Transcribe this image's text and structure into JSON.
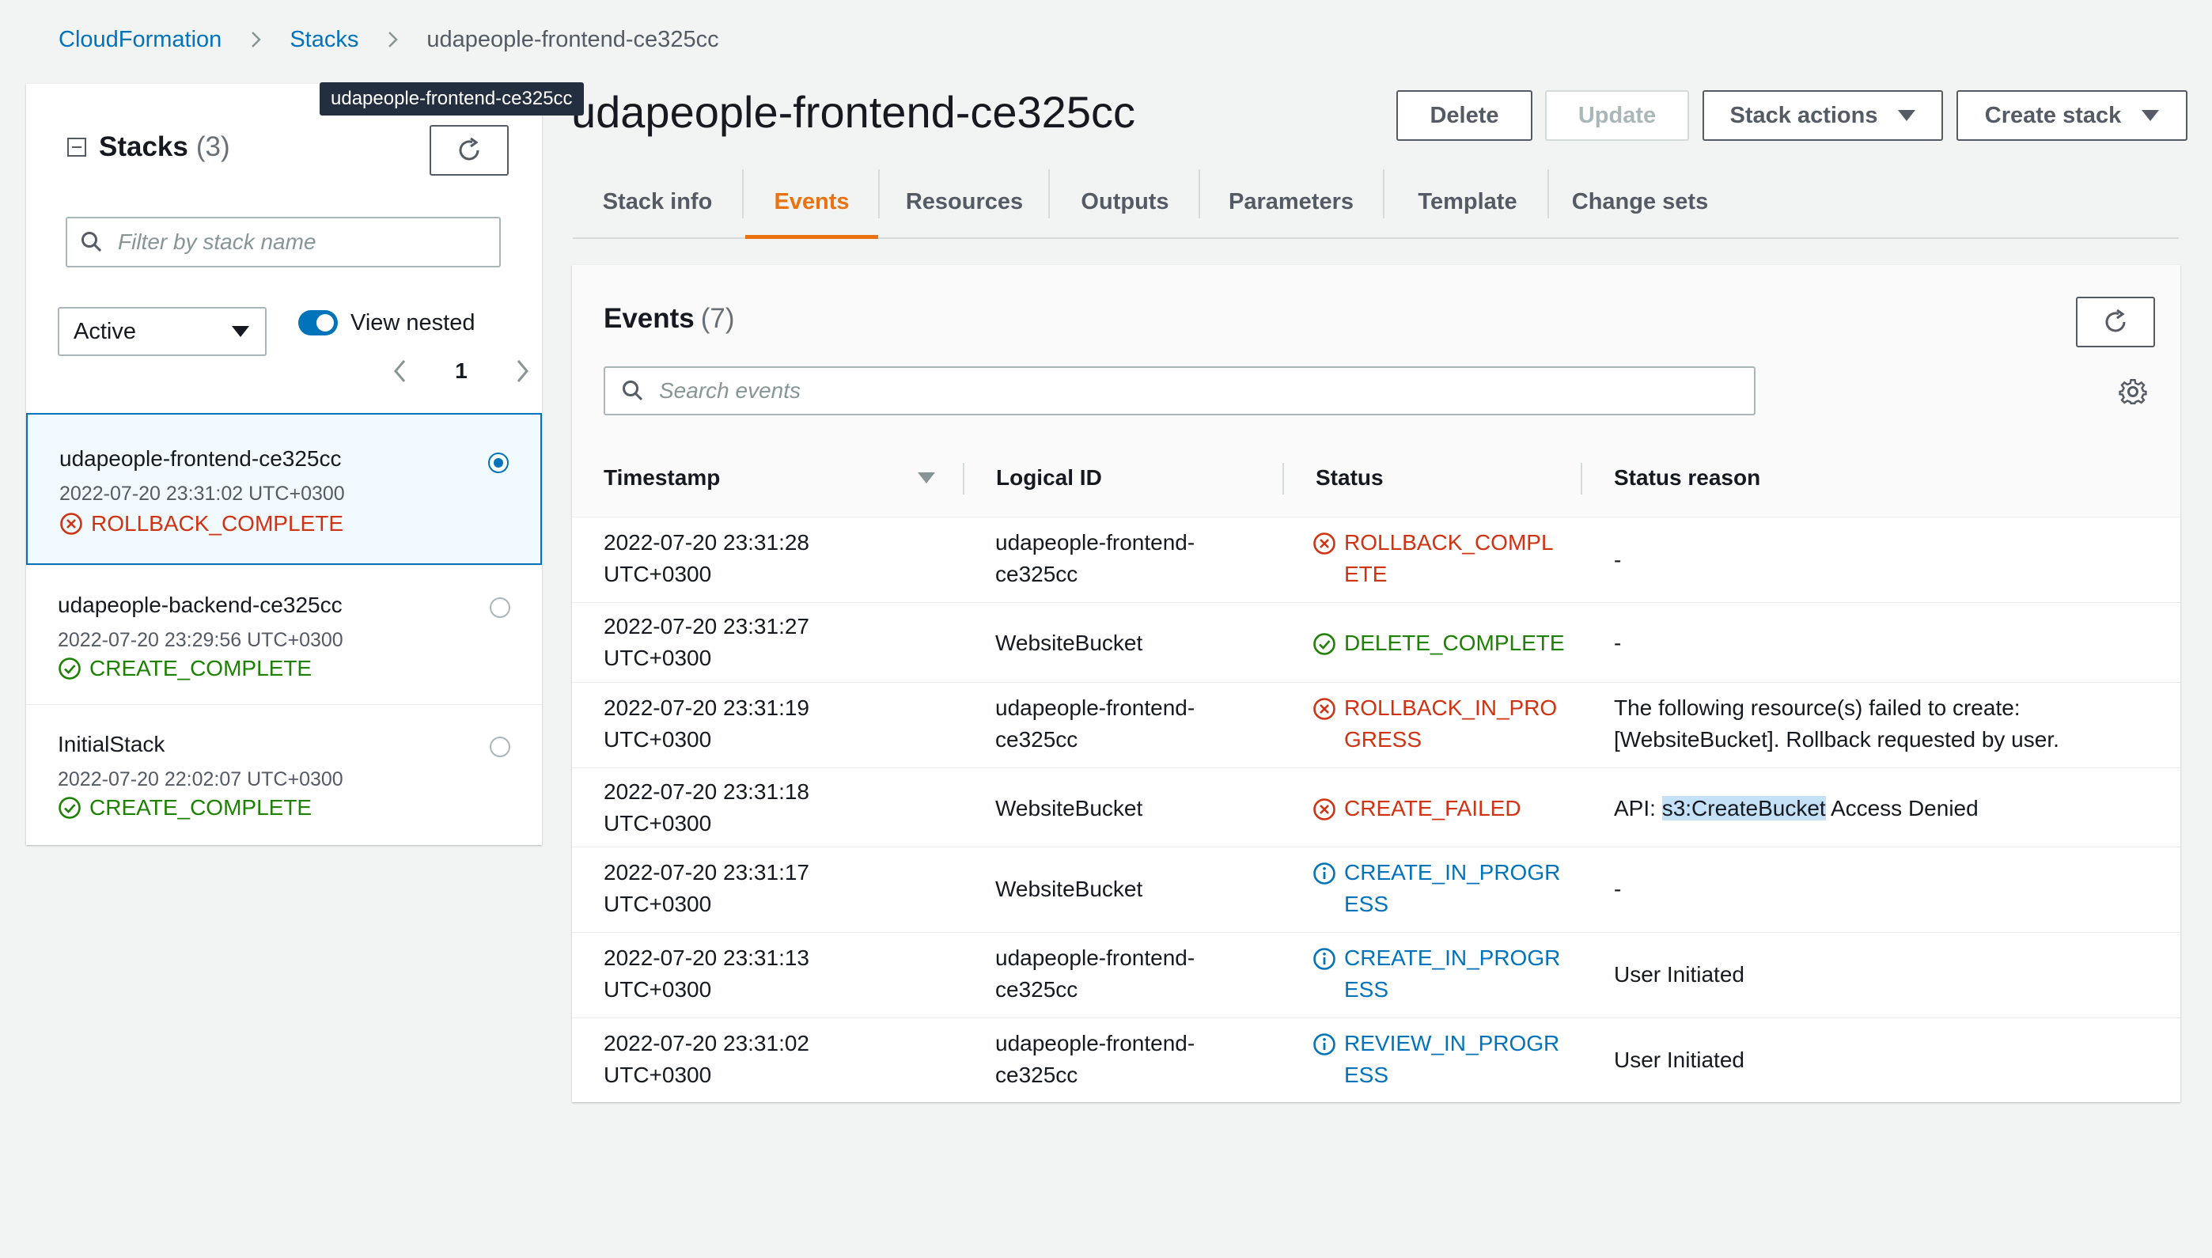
{
  "breadcrumb": [
    "CloudFormation",
    "Stacks",
    "udapeople-frontend-ce325cc"
  ],
  "tooltip": "udapeople-frontend-ce325cc",
  "sidebar": {
    "title": "Stacks",
    "count": "(3)",
    "filter_placeholder": "Filter by stack name",
    "filter_select": "Active",
    "view_nested_label": "View nested",
    "page": "1",
    "stacks": [
      {
        "name": "udapeople-frontend-ce325cc",
        "time": "2022-07-20 23:31:02 UTC+0300",
        "status": "ROLLBACK_COMPLETE",
        "icon": "error-icon",
        "selected": true
      },
      {
        "name": "udapeople-backend-ce325cc",
        "time": "2022-07-20 23:29:56 UTC+0300",
        "status": "CREATE_COMPLETE",
        "icon": "success-icon",
        "selected": false
      },
      {
        "name": "InitialStack",
        "time": "2022-07-20 22:02:07 UTC+0300",
        "status": "CREATE_COMPLETE",
        "icon": "success-icon",
        "selected": false
      }
    ]
  },
  "header": {
    "title": "udapeople-frontend-ce325cc",
    "delete_label": "Delete",
    "update_label": "Update",
    "stack_actions_label": "Stack actions",
    "create_stack_label": "Create stack"
  },
  "tabs": [
    "Stack info",
    "Events",
    "Resources",
    "Outputs",
    "Parameters",
    "Template",
    "Change sets"
  ],
  "active_tab": "Events",
  "events": {
    "title": "Events",
    "count": "(7)",
    "search_placeholder": "Search events",
    "columns": [
      "Timestamp",
      "Logical ID",
      "Status",
      "Status reason"
    ],
    "rows": [
      {
        "ts1": "2022-07-20 23:31:28",
        "ts2": "UTC+0300",
        "lid1": "udapeople-frontend-",
        "lid2": "ce325cc",
        "status": "ROLLBACK_COMPLETE",
        "status_l1": "ROLLBACK_COMPL",
        "status_l2": "ETE",
        "icon": "error-icon",
        "reason": "-"
      },
      {
        "ts1": "2022-07-20 23:31:27",
        "ts2": "UTC+0300",
        "lid1": "WebsiteBucket",
        "lid2": "",
        "status": "DELETE_COMPLETE",
        "status_l1": "DELETE_COMPLETE",
        "status_l2": "",
        "icon": "success-icon",
        "reason": "-"
      },
      {
        "ts1": "2022-07-20 23:31:19",
        "ts2": "UTC+0300",
        "lid1": "udapeople-frontend-",
        "lid2": "ce325cc",
        "status": "ROLLBACK_IN_PROGRESS",
        "status_l1": "ROLLBACK_IN_PRO",
        "status_l2": "GRESS",
        "icon": "error-icon",
        "reason": "The following resource(s) failed to create:",
        "reason2": "[WebsiteBucket]. Rollback requested by user."
      },
      {
        "ts1": "2022-07-20 23:31:18",
        "ts2": "UTC+0300",
        "lid1": "WebsiteBucket",
        "lid2": "",
        "status": "CREATE_FAILED",
        "status_l1": "CREATE_FAILED",
        "status_l2": "",
        "icon": "error-icon",
        "reason_pre": "API: ",
        "reason_hl": "s3:CreateBucket",
        "reason_post": " Access Denied"
      },
      {
        "ts1": "2022-07-20 23:31:17",
        "ts2": "UTC+0300",
        "lid1": "WebsiteBucket",
        "lid2": "",
        "status": "CREATE_IN_PROGRESS",
        "status_l1": "CREATE_IN_PROGR",
        "status_l2": "ESS",
        "icon": "info-icon",
        "reason": "-"
      },
      {
        "ts1": "2022-07-20 23:31:13",
        "ts2": "UTC+0300",
        "lid1": "udapeople-frontend-",
        "lid2": "ce325cc",
        "status": "CREATE_IN_PROGRESS",
        "status_l1": "CREATE_IN_PROGR",
        "status_l2": "ESS",
        "icon": "info-icon",
        "reason": "User Initiated"
      },
      {
        "ts1": "2022-07-20 23:31:02",
        "ts2": "UTC+0300",
        "lid1": "udapeople-frontend-",
        "lid2": "ce325cc",
        "status": "REVIEW_IN_PROGRESS",
        "status_l1": "REVIEW_IN_PROGR",
        "status_l2": "ESS",
        "icon": "info-icon",
        "reason": "User Initiated"
      }
    ]
  },
  "colors": {
    "link": "#0073bb",
    "accent": "#ec7211",
    "error": "#d13212",
    "success": "#1d8102",
    "info": "#0073bb"
  }
}
